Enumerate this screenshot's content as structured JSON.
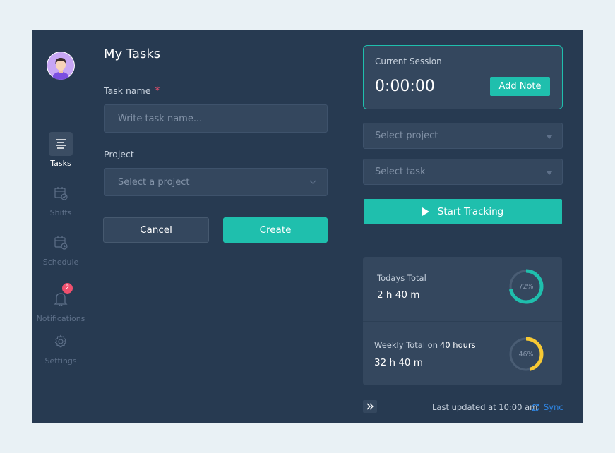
{
  "sidebar": {
    "items": [
      {
        "label": "Tasks",
        "icon": "list-icon",
        "active": true
      },
      {
        "label": "Shifts",
        "icon": "calendar-check-icon"
      },
      {
        "label": "Schedule",
        "icon": "calendar-clock-icon"
      },
      {
        "label": "Notifications",
        "icon": "bell-icon",
        "badge": "2"
      },
      {
        "label": "Settings",
        "icon": "gear-icon"
      }
    ]
  },
  "form": {
    "title": "My Tasks",
    "task_name_label": "Task name",
    "required_mark": "*",
    "task_name_placeholder": "Write task name...",
    "project_label": "Project",
    "project_placeholder": "Select a project",
    "cancel_label": "Cancel",
    "create_label": "Create"
  },
  "session": {
    "label": "Current Session",
    "timer": "0:00:00",
    "add_note_label": "Add Note",
    "select_project": "Select project",
    "select_task": "Select task",
    "start_label": "Start Tracking"
  },
  "totals": {
    "today": {
      "label": "Todays Total",
      "value": "2 h 40 m",
      "percent": 72,
      "percent_label": "72%",
      "color": "#1fbfad"
    },
    "weekly": {
      "label": "Weekly Total on",
      "target": "40 hours",
      "value": "32 h 40 m",
      "percent": 46,
      "percent_label": "46%",
      "color": "#f7c934"
    }
  },
  "footer": {
    "updated": "Last updated at 10:00 am",
    "sync_label": "Sync"
  },
  "colors": {
    "accent": "#1fbfad",
    "background": "#273a51",
    "panel": "#34475e",
    "badge": "#f0506e",
    "link": "#2f86e4"
  }
}
